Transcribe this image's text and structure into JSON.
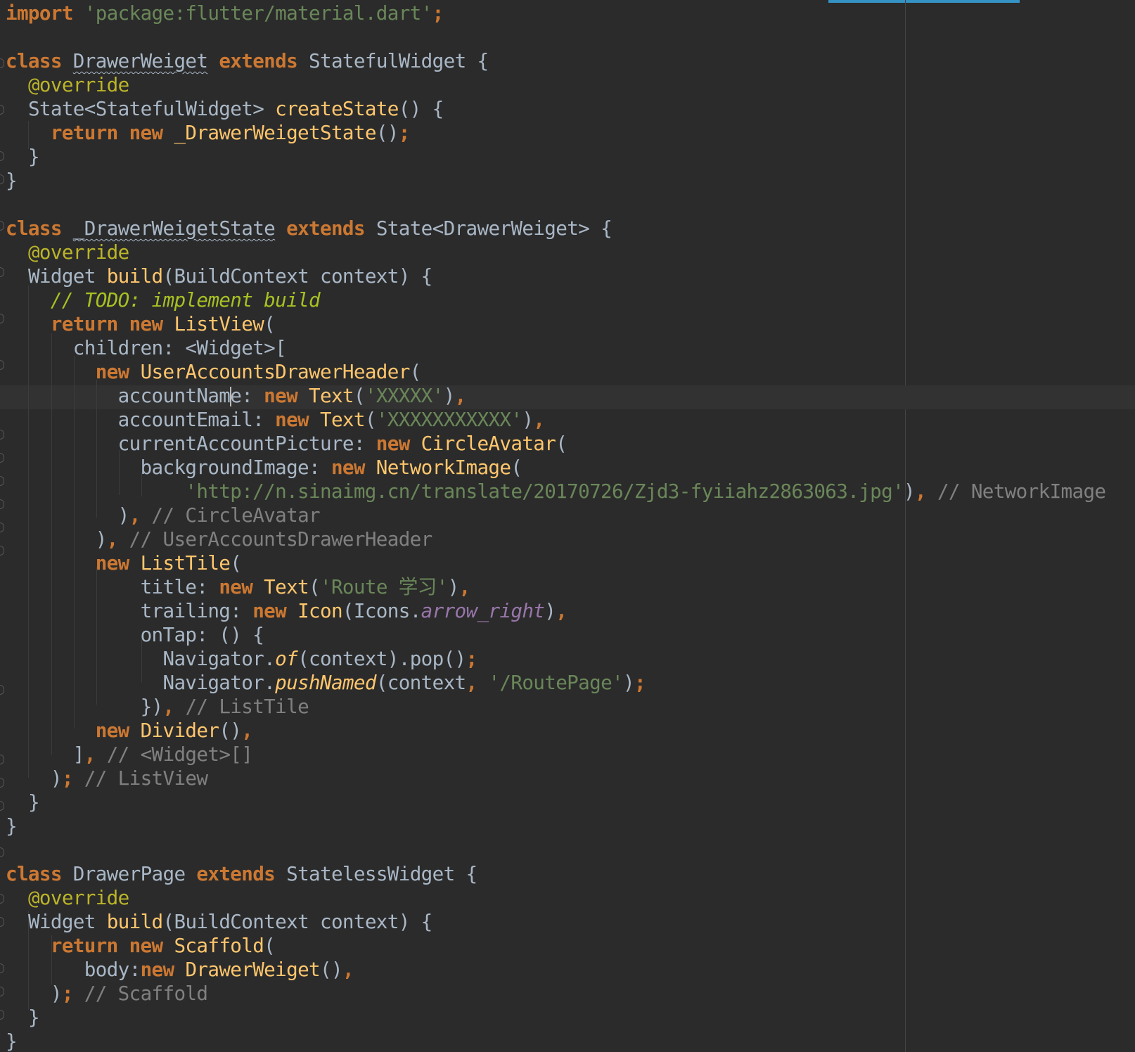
{
  "editor": {
    "language": "Dart",
    "colors": {
      "background": "#2b2b2b",
      "keyword": "#cc7832",
      "string": "#6a8759",
      "comment": "#808080",
      "todo": "#a8c023",
      "annotation": "#bbb529",
      "function": "#ffc66d",
      "plain": "#a9b7c6",
      "property": "#9876aa",
      "scroll_indicator": "#3592c4"
    },
    "code": {
      "t1": "import",
      "t2": "'package:flutter/material.dart'",
      "t3": ";",
      "t4": "class",
      "t5": "DrawerWeiget",
      "t6": "extends",
      "t7": "StatefulWidget {",
      "t8": "@override",
      "t9": "State<StatefulWidget> ",
      "t10": "createState",
      "t11": "() {",
      "t12": "return new",
      "t13": "_DrawerWeigetState",
      "t14": "()",
      "t15": ";",
      "t16": "}",
      "t17": "}",
      "t18": "class",
      "t19": "_DrawerWeigetState",
      "t20": "extends",
      "t21": "State<DrawerWeiget> {",
      "t22": "@override",
      "t23": "Widget ",
      "t24": "build",
      "t25": "(BuildContext context) {",
      "t26": "// TODO: implement build",
      "t27": "return new",
      "t28": "ListView",
      "t29": "(",
      "t30": "children: <Widget>[",
      "t31": "new",
      "t32": "UserAccountsDrawerHeader",
      "t33": "(",
      "t34a": "accountNam",
      "t34b": "e: ",
      "t35": "new",
      "t36": "Text",
      "t37": "(",
      "t38": "'XXXXX'",
      "t39": ")",
      "t40": ",",
      "t41": "accountEmail: ",
      "t42": "new",
      "t43": "Text",
      "t44": "(",
      "t45": "'XXXXXXXXXXX'",
      "t46": ")",
      "t47": ",",
      "t48": "currentAccountPicture: ",
      "t49": "new",
      "t50": "CircleAvatar",
      "t51": "(",
      "t52": "backgroundImage: ",
      "t53": "new",
      "t54": "NetworkImage",
      "t55": "(",
      "t56": "'http://n.sinaimg.cn/translate/20170726/Zjd3-fyiiahz2863063.jpg'",
      "t57": ")",
      "t58": ",",
      "t59": "// NetworkImage",
      "t60": ")",
      "t61": ",",
      "t62": "// CircleAvatar",
      "t63": ")",
      "t64": ",",
      "t65": "// UserAccountsDrawerHeader",
      "t66": "new",
      "t67": "ListTile",
      "t68": "(",
      "t69": "title: ",
      "t70": "new",
      "t71": "Text",
      "t72": "(",
      "t73": "'Route 学习'",
      "t74": ")",
      "t75": ",",
      "t76": "trailing: ",
      "t77": "new",
      "t78": "Icon",
      "t79": "(Icons.",
      "t80": "arrow_right",
      "t81": ")",
      "t82": ",",
      "t83": "onTap: () {",
      "t84": "Navigator.",
      "t85": "of",
      "t86": "(context).pop()",
      "t87": ";",
      "t88": "Navigator.",
      "t89": "pushNamed",
      "t90": "(context",
      "t91": ", ",
      "t92": "'/RoutePage'",
      "t93": ")",
      "t94": ";",
      "t95": "})",
      "t96": ",",
      "t97": "// ListTile",
      "t98": "new",
      "t99": "Divider",
      "t100": "()",
      "t101": ",",
      "t102": "]",
      "t103": ",",
      "t104": "// <Widget>[]",
      "t105": ")",
      "t106": ";",
      "t107": "// ListView",
      "t108": "}",
      "t109": "}",
      "t110": "class",
      "t111": "DrawerPage",
      "t112": "extends",
      "t113": "StatelessWidget {",
      "t114": "@override",
      "t115": "Widget ",
      "t116": "build",
      "t117": "(BuildContext context) {",
      "t118": "return new",
      "t119": "Scaffold",
      "t120": "(",
      "t121": "body:",
      "t122": "new",
      "t123": "DrawerWeiget",
      "t124": "()",
      "t125": ",",
      "t126": ")",
      "t127": ";",
      "t128": "// Scaffold",
      "t129": "}",
      "t130": "}"
    }
  }
}
